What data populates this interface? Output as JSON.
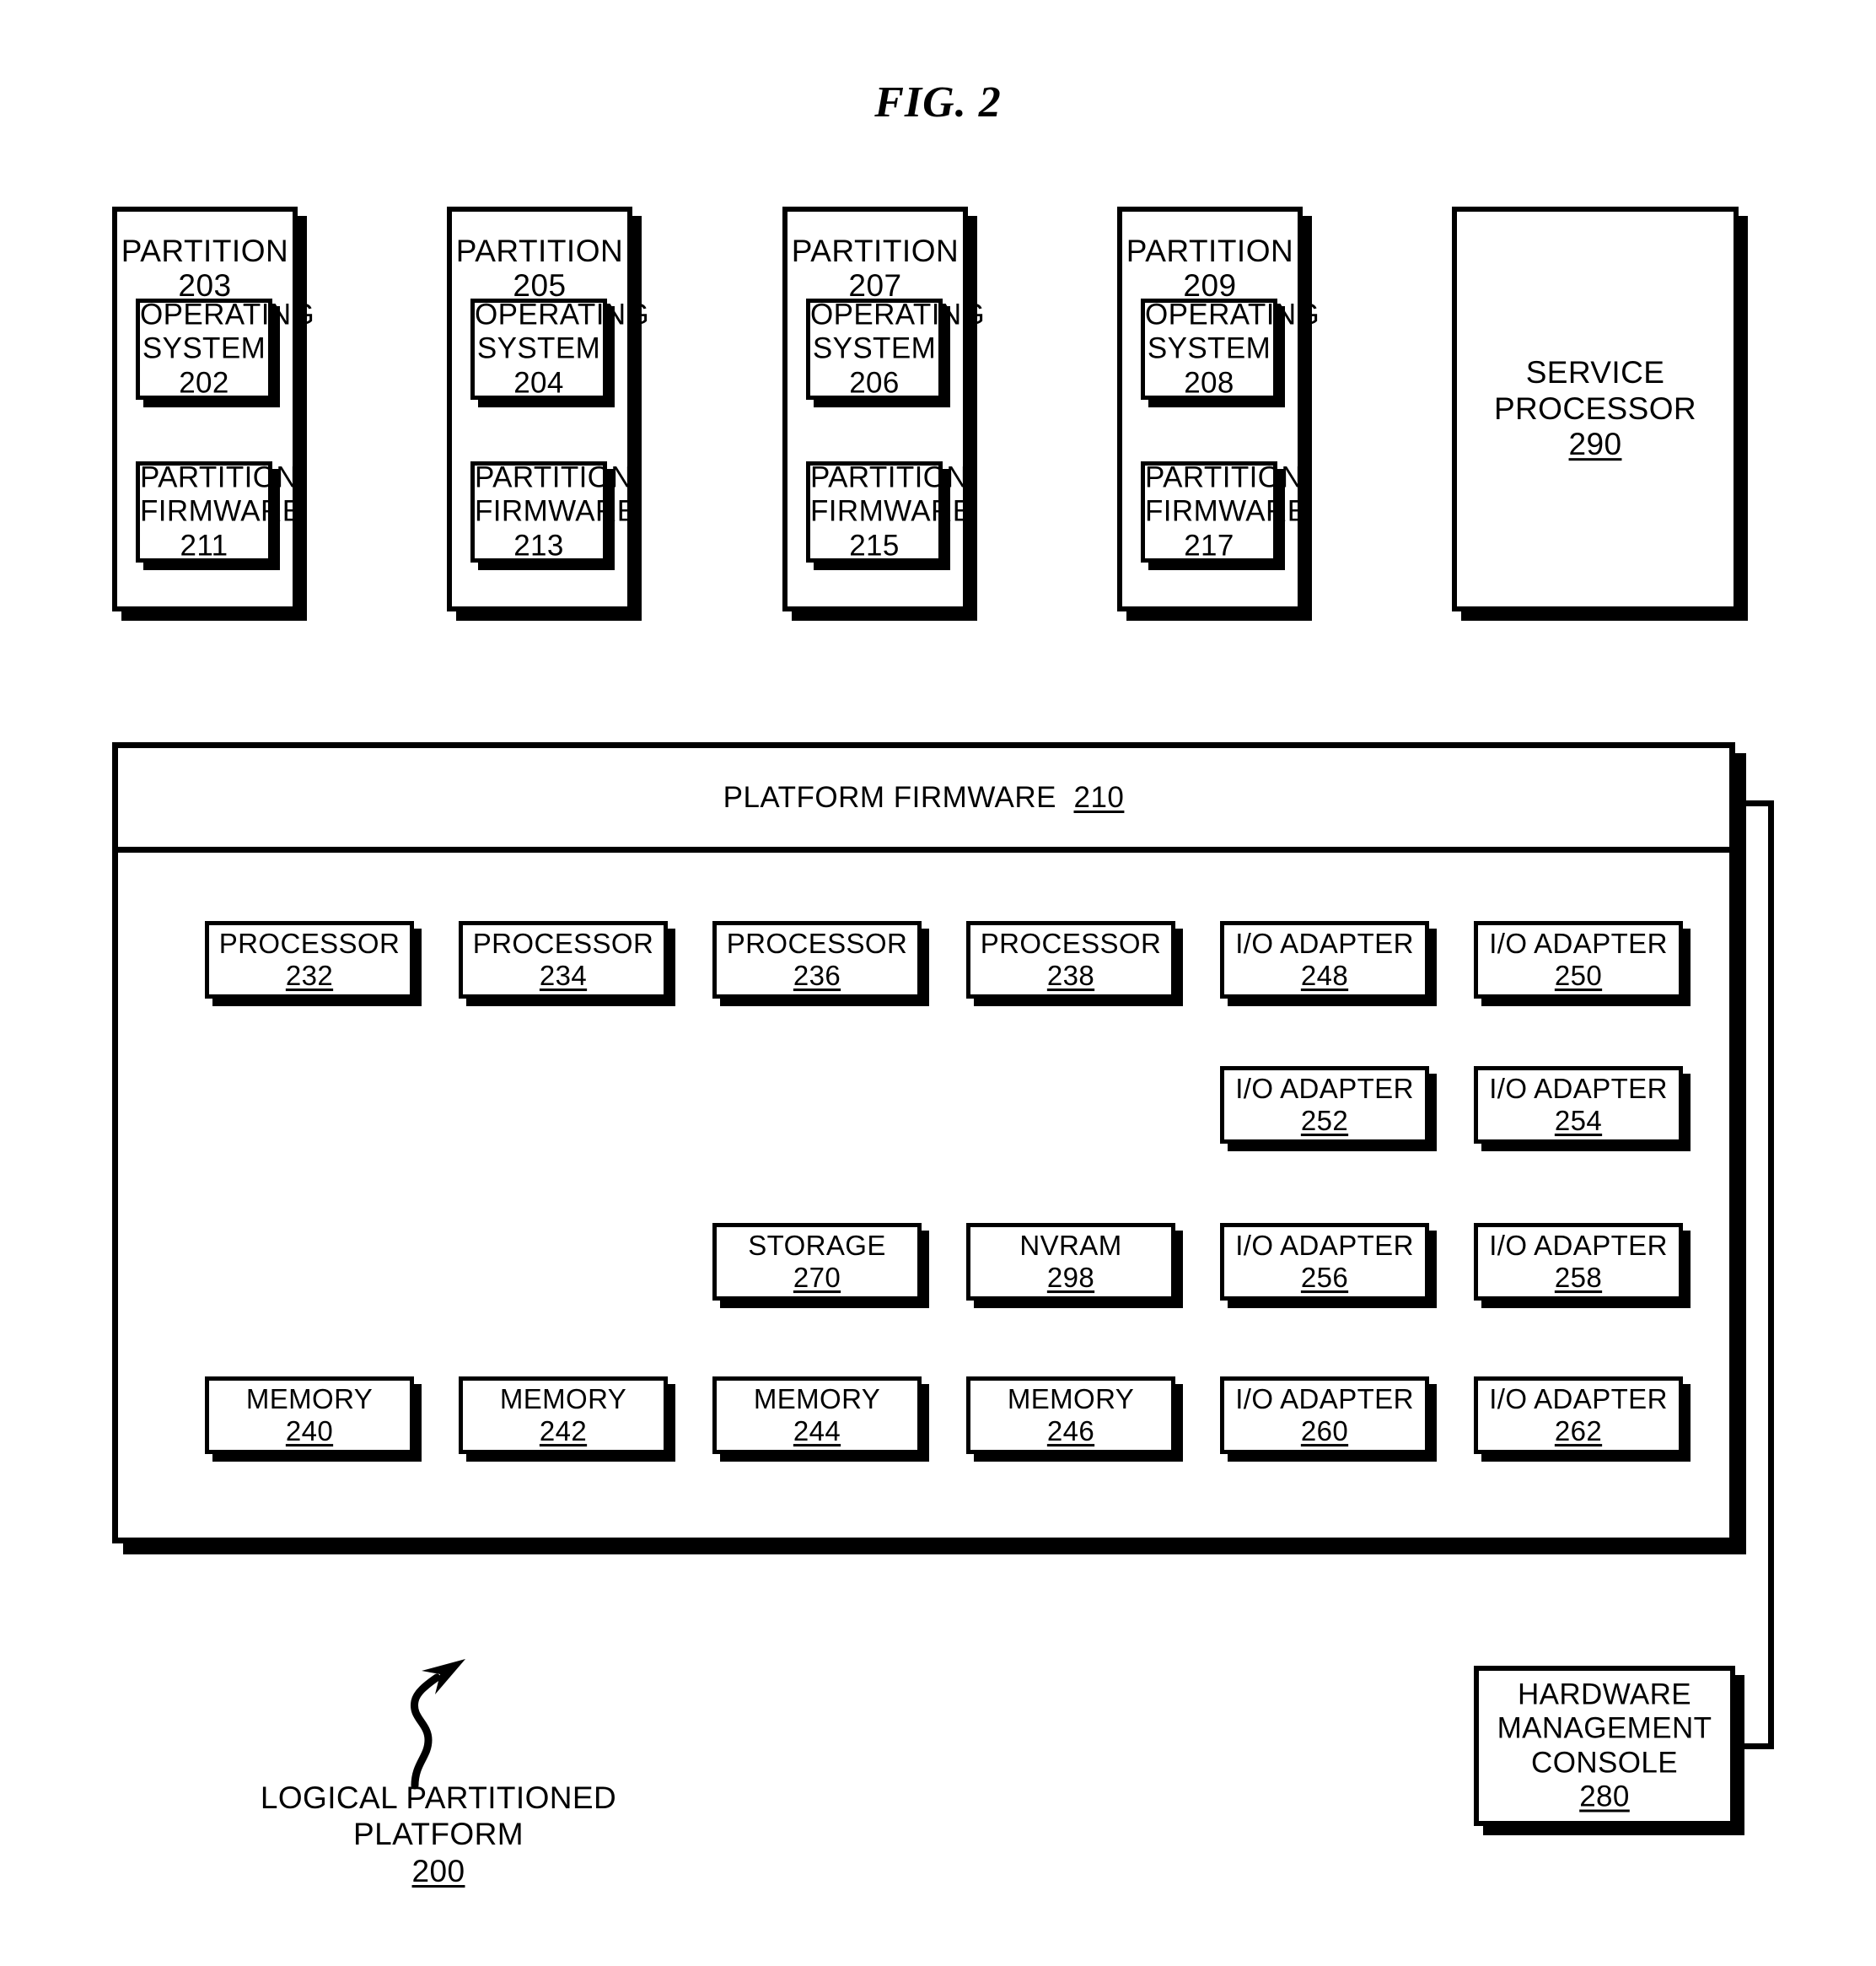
{
  "figure": {
    "title": "FIG. 2"
  },
  "partitions": [
    {
      "title_text": "PARTITION",
      "title_ref": "203",
      "os": {
        "line1": "OPERATING",
        "line2": "SYSTEM",
        "ref": "202"
      },
      "fw": {
        "line1": "PARTITION",
        "line2": "FIRMWARE",
        "ref": "211"
      }
    },
    {
      "title_text": "PARTITION",
      "title_ref": "205",
      "os": {
        "line1": "OPERATING",
        "line2": "SYSTEM",
        "ref": "204"
      },
      "fw": {
        "line1": "PARTITION",
        "line2": "FIRMWARE",
        "ref": "213"
      }
    },
    {
      "title_text": "PARTITION",
      "title_ref": "207",
      "os": {
        "line1": "OPERATING",
        "line2": "SYSTEM",
        "ref": "206"
      },
      "fw": {
        "line1": "PARTITION",
        "line2": "FIRMWARE",
        "ref": "215"
      }
    },
    {
      "title_text": "PARTITION",
      "title_ref": "209",
      "os": {
        "line1": "OPERATING",
        "line2": "SYSTEM",
        "ref": "208"
      },
      "fw": {
        "line1": "PARTITION",
        "line2": "FIRMWARE",
        "ref": "217"
      }
    }
  ],
  "service_processor": {
    "line1": "SERVICE",
    "line2": "PROCESSOR",
    "ref": "290"
  },
  "platform_firmware": {
    "label": "PLATFORM FIRMWARE",
    "ref": "210"
  },
  "resources": {
    "row1": [
      {
        "label": "PROCESSOR",
        "ref": "232"
      },
      {
        "label": "PROCESSOR",
        "ref": "234"
      },
      {
        "label": "PROCESSOR",
        "ref": "236"
      },
      {
        "label": "PROCESSOR",
        "ref": "238"
      },
      {
        "label": "I/O ADAPTER",
        "ref": "248"
      },
      {
        "label": "I/O ADAPTER",
        "ref": "250"
      }
    ],
    "row2": [
      {
        "label": "I/O ADAPTER",
        "ref": "252"
      },
      {
        "label": "I/O ADAPTER",
        "ref": "254"
      }
    ],
    "row3": [
      {
        "label": "STORAGE",
        "ref": "270"
      },
      {
        "label": "NVRAM",
        "ref": "298"
      },
      {
        "label": "I/O ADAPTER",
        "ref": "256"
      },
      {
        "label": "I/O ADAPTER",
        "ref": "258"
      }
    ],
    "row4": [
      {
        "label": "MEMORY",
        "ref": "240"
      },
      {
        "label": "MEMORY",
        "ref": "242"
      },
      {
        "label": "MEMORY",
        "ref": "244"
      },
      {
        "label": "MEMORY",
        "ref": "246"
      },
      {
        "label": "I/O ADAPTER",
        "ref": "260"
      },
      {
        "label": "I/O ADAPTER",
        "ref": "262"
      }
    ]
  },
  "hmc": {
    "line1": "HARDWARE",
    "line2": "MANAGEMENT",
    "line3": "CONSOLE",
    "ref": "280"
  },
  "caption": {
    "line1": "LOGICAL PARTITIONED",
    "line2": "PLATFORM",
    "ref": "200"
  },
  "colors": {
    "ink": "#000000",
    "paper": "#ffffff"
  }
}
